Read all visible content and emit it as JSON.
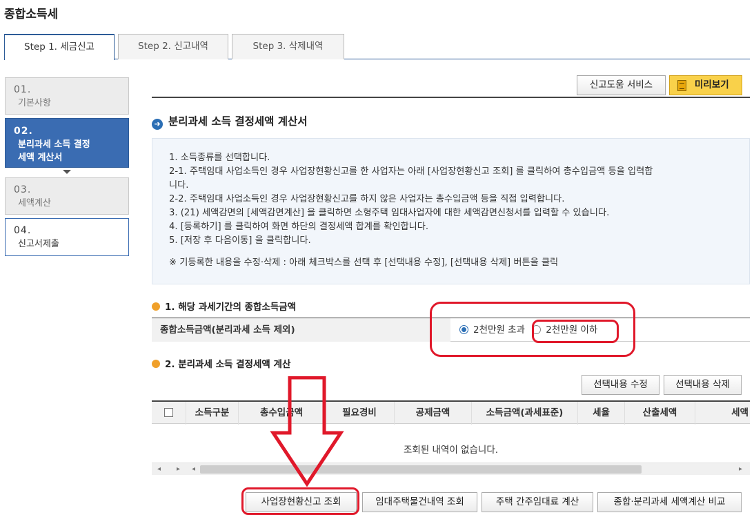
{
  "app": {
    "title": "종합소득세"
  },
  "tabs": [
    {
      "label": "Step 1. 세금신고",
      "active": true
    },
    {
      "label": "Step 2. 신고내역",
      "active": false
    },
    {
      "label": "Step 3. 삭제내역",
      "active": false
    }
  ],
  "steps": [
    {
      "num": "01.",
      "label": "기본사항",
      "state": "inactive"
    },
    {
      "num": "02.",
      "label": "분리과세 소득 결정",
      "label2": "세액 계산서",
      "state": "active"
    },
    {
      "num": "03.",
      "label": "세액계산",
      "state": "inactive"
    },
    {
      "num": "04.",
      "label": "신고서제출",
      "state": "done"
    }
  ],
  "toolbar": {
    "help_label": "신고도움 서비스",
    "preview_label": "미리보기"
  },
  "section": {
    "title": "분리과세 소득 결정세액 계산서"
  },
  "info": {
    "lines": [
      "1. 소득종류를 선택합니다.",
      "2-1. 주택임대 사업소득인 경우 사업장현황신고를 한 사업자는 아래 [사업장현황신고 조회] 를 클릭하여 총수입금액 등을 입력합",
      "니다.",
      "2-2. 주택임대 사업소득인 경우 사업장현황신고를 하지 않은 사업자는 총수입금액 등을 직접 입력합니다.",
      "3. (21) 세액감면의 [세액감면계산] 을 클릭하면 소형주택 임대사업자에 대한 세액감면신청서를 입력할 수 있습니다.",
      "4. [등록하기] 를 클릭하여 화면 하단의 결정세액 합계를 확인합니다.",
      "5. [저장 후 다음이동] 을 클릭합니다."
    ],
    "note": "※ 기등록한 내용을 수정·삭제 : 아래 체크박스를 선택 후 [선택내용 수정], [선택내용 삭제] 버튼을 클릭"
  },
  "income_section": {
    "title": "1. 해당 과세기간의 종합소득금액",
    "field_label": "종합소득금액(분리과세 소득 제외)",
    "options": [
      {
        "label": "2천만원 초과",
        "selected": true
      },
      {
        "label": "2천만원 이하",
        "selected": false
      }
    ]
  },
  "tax_section": {
    "title": "2. 분리과세 소득 결정세액 계산",
    "edit_label": "선택내용 수정",
    "delete_label": "선택내용 삭제",
    "columns": [
      "소득구분",
      "총수입금액",
      "필요경비",
      "공제금액",
      "소득금액(과세표준)",
      "세율",
      "산출세액",
      "세액"
    ],
    "empty_message": "조회된 내역이 없습니다."
  },
  "bottom_buttons": {
    "business_status": "사업장현황신고 조회",
    "rental_property": "임대주택물건내역 조회",
    "deemed_rent": "주택 간주임대료 계산",
    "compare": "종합·분리과세 세액계산 비교"
  },
  "colors": {
    "accent_blue": "#3a6cb2",
    "highlight_red": "#e0182a",
    "preview_yellow": "#f9d14a"
  }
}
